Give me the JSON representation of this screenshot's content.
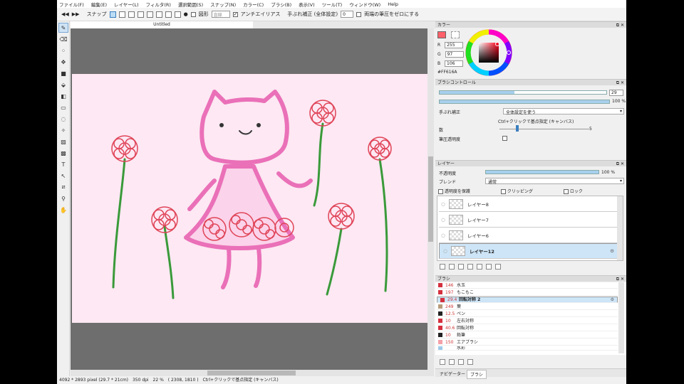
{
  "menu": [
    "ファイル(F)",
    "編集(E)",
    "レイヤー(L)",
    "フィルタ(R)",
    "選択範囲(S)",
    "スナップ(N)",
    "カラー(C)",
    "ブラシ(B)",
    "表示(V)",
    "ツール(T)",
    "ウィンドウ(W)",
    "Help"
  ],
  "toolbar": {
    "snap_label": "スナップ",
    "shape_label": "図形",
    "shape_select": "直線",
    "antialias_label": "アンチエイリアス",
    "stabilizer_label": "手ぶれ補正 (全体設定)",
    "stabilizer_value": "0",
    "pressure_label": "両端の筆圧をゼロにする"
  },
  "document": {
    "tab_title": "Untitled"
  },
  "status": {
    "size": "4092 * 2893 pixel",
    "physical": "(29.7 * 21cm)",
    "dpi": "350 dpi",
    "zoom": "22 %",
    "coords": "( 2308, 1810 )",
    "hint": "Ctrl+クリックで基点指定 (キャンバス)"
  },
  "color_panel": {
    "title": "カラー",
    "r_label": "R",
    "r": "255",
    "g_label": "G",
    "g": "97",
    "b_label": "B",
    "b": "106",
    "hex": "#FF616A",
    "fg_color": "#ff616a"
  },
  "brush_control": {
    "title": "ブラシコントロール",
    "size": "29",
    "size_fraction": 0.45,
    "opacity": "100 %",
    "opacity_fraction": 1.0,
    "stabilizer_label": "手ぶれ補正",
    "stabilizer_value": "全体設定を使う",
    "hint": "Ctrl+クリックで基点指定 (キャンバス)",
    "count_label": "数",
    "count_value": "5",
    "count_fraction": 0.2,
    "pressure_opacity_label": "筆圧透明度"
  },
  "layers_panel": {
    "title": "レイヤー",
    "opacity_label": "不透明度",
    "opacity_value": "100 %",
    "opacity_fraction": 1.0,
    "blend_label": "ブレンド",
    "blend_value": "通常",
    "protect_label": "透明度を保護",
    "clipping_label": "クリッピング",
    "lock_label": "ロック",
    "layers": [
      "レイヤー8",
      "レイヤー7",
      "レイヤー6",
      "レイヤー12"
    ]
  },
  "brush_panel": {
    "title": "ブラシ",
    "items": [
      {
        "size": "146",
        "name": "水玉",
        "color": "#d4303e"
      },
      {
        "size": "197",
        "name": "もこもこ",
        "color": "#d4303e"
      },
      {
        "size": "29.4",
        "name": "回転対称 2",
        "color": "#d4303e"
      },
      {
        "size": "249",
        "name": "葉",
        "color": "#b89a7a"
      },
      {
        "size": "12.5",
        "name": "ペン",
        "color": "#222222"
      },
      {
        "size": "10",
        "name": "左右対称",
        "color": "#d4303e"
      },
      {
        "size": "40.6",
        "name": "回転対称",
        "color": "#d4303e"
      },
      {
        "size": "10",
        "name": "鉛筆",
        "color": "#222222"
      },
      {
        "size": "150",
        "name": "エアブラシ",
        "color": "#f4a0a8"
      },
      {
        "size": "",
        "name": "水彩",
        "color": "#9ec9e8"
      }
    ]
  },
  "bottom_tabs": {
    "navigator": "ナビゲーター",
    "brush": "ブラシ"
  }
}
